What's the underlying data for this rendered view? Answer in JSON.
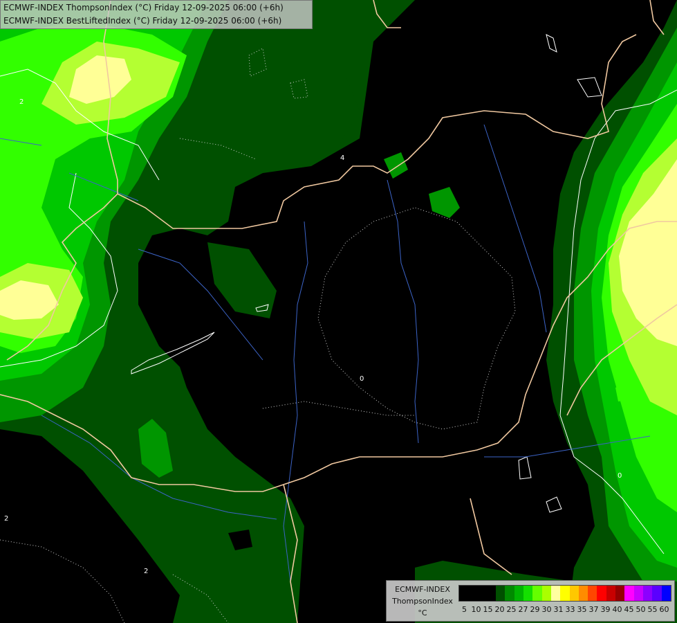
{
  "header": {
    "line1": "ECMWF-INDEX ThompsonIndex (°C) Friday 12-09-2025 06:00 (+6h)",
    "line2": "ECMWF-INDEX BestLiftedIndex (°C) Friday 12-09-2025 06:00 (+6h)"
  },
  "legend": {
    "title1": "ECMWF-INDEX",
    "title2": "ThompsonIndex",
    "unit": "°C",
    "colors": [
      "#000000",
      "#000000",
      "#000000",
      "#000000",
      "#004f00",
      "#008a00",
      "#00b400",
      "#14e000",
      "#64ff00",
      "#aaff00",
      "#ffffa0",
      "#ffff00",
      "#ffc800",
      "#ff8c00",
      "#ff4600",
      "#ff0000",
      "#c80000",
      "#960000",
      "#ff00ff",
      "#c800ff",
      "#8c00ff",
      "#5a00ff",
      "#0000ff"
    ],
    "labels": [
      "5",
      "10",
      "15",
      "20",
      "25",
      "27",
      "29",
      "30",
      "31",
      "33",
      "35",
      "37",
      "39",
      "40",
      "45",
      "50",
      "55",
      "60"
    ]
  },
  "contour_labels": [
    "2",
    "2",
    "2",
    "4",
    "0",
    "0"
  ],
  "colors": {
    "land_black": "#000000",
    "dark_green": "#005000",
    "green": "#009600",
    "bright_green": "#00c800",
    "lime": "#32ff00",
    "yellow_green": "#b4ff32",
    "pale_yellow": "#ffff96",
    "border": "#f0c8a0",
    "river": "#3c64c8"
  }
}
